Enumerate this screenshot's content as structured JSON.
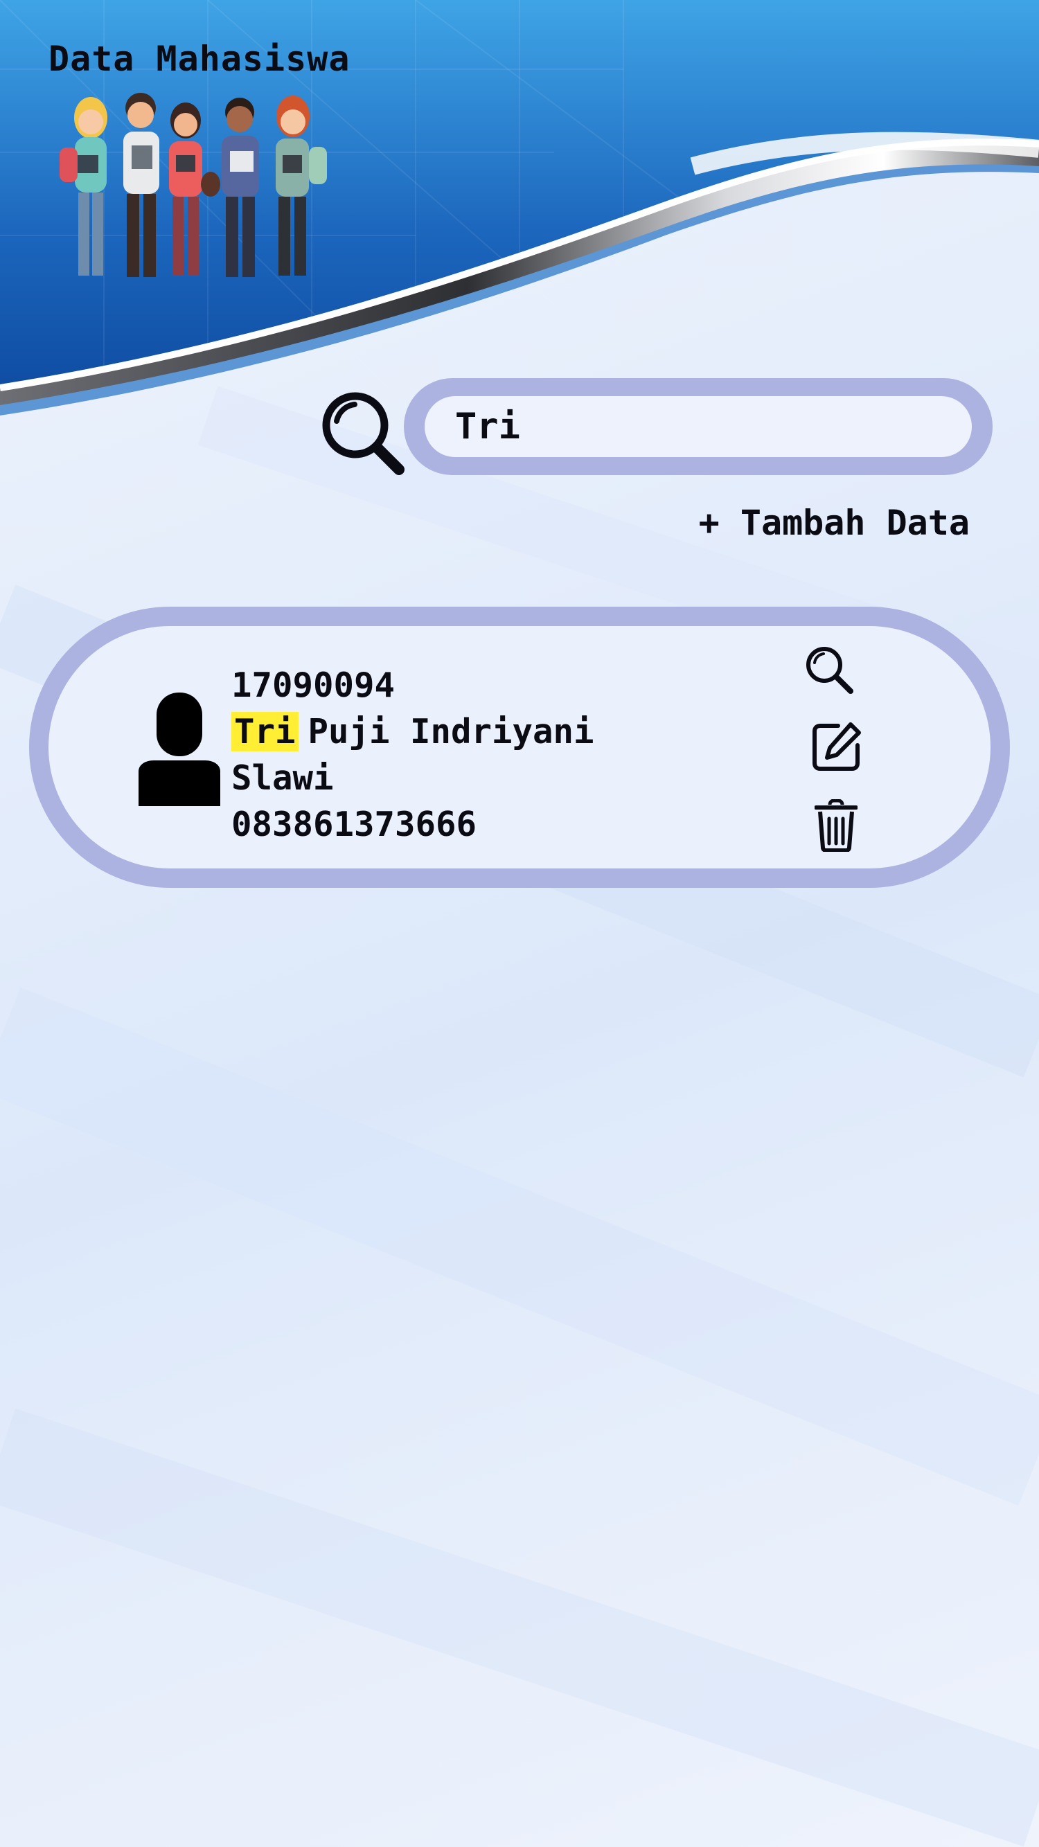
{
  "app": {
    "title": "Data Mahasiswa"
  },
  "search": {
    "value": "Tri",
    "icon": "search-icon"
  },
  "actions": {
    "add_label": "+ Tambah Data"
  },
  "results": [
    {
      "nim": "17090094",
      "name_match": "Tri",
      "name_rest": "Puji Indriyani",
      "city": "Slawi",
      "phone": "083861373666",
      "icons": [
        "person-avatar-icon",
        "magnifier-detail-icon",
        "edit-icon",
        "trash-icon"
      ]
    }
  ],
  "colors": {
    "header_blue": "#1f6fc4",
    "pill_border": "#adb3e0",
    "highlight": "#ffee33",
    "text": "#0b0b14"
  }
}
